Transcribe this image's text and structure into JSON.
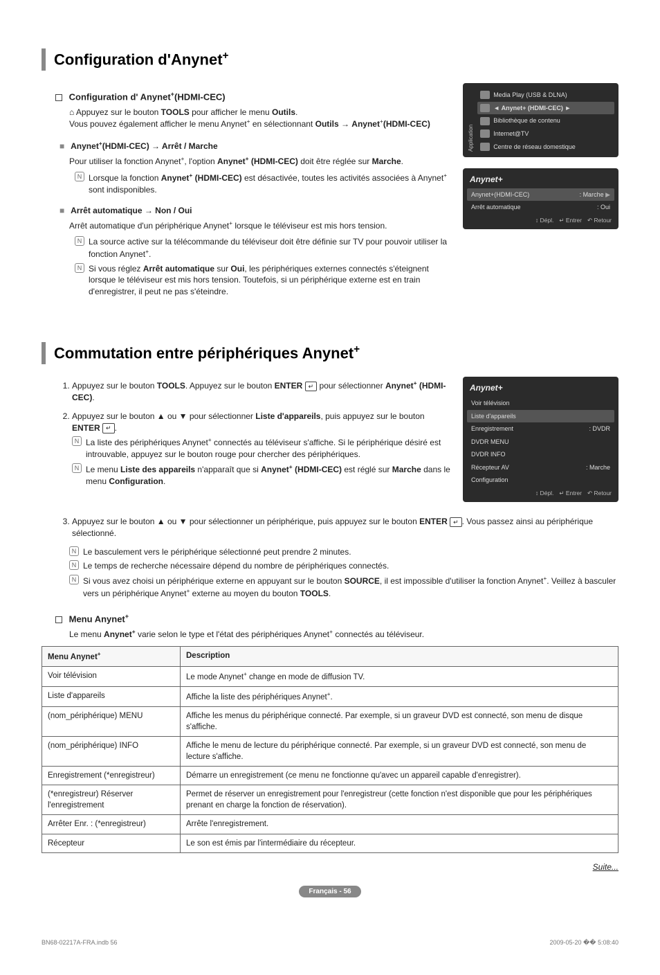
{
  "section1": {
    "title_prefix": "Configuration d'Anynet",
    "sup": "+",
    "sub1_prefix": "Configuration d' Anynet",
    "sub1_suffix": "(HDMI-CEC)",
    "p1a": "Appuyez sur le bouton ",
    "p1_tools": "TOOLS",
    "p1b": " pour afficher le menu ",
    "p1_outils": "Outils",
    "p1c": ".",
    "p2a": "Vous pouvez également afficher le menu Anynet",
    "p2b": " en sélectionnant ",
    "p2_outils": "Outils",
    "p2_arrow": " → ",
    "p2_anynet": "Anynet",
    "p2_suffix": "(HDMI-CEC)",
    "item1_head_a": "Anynet",
    "item1_head_b": "(HDMI-CEC) → Arrêt / Marche",
    "item1_p_a": "Pour utiliser la fonction Anynet",
    "item1_p_b": ", l'option ",
    "item1_p_anynet": "Anynet",
    "item1_p_sup": "+",
    "item1_p_hdmi": " (HDMI-CEC)",
    "item1_p_c": " doit être réglée sur ",
    "item1_p_marche": "Marche",
    "item1_p_d": ".",
    "note1a": "Lorsque la fonction ",
    "note1b": "Anynet",
    "note1sup": "+",
    "note1c": " (HDMI-CEC)",
    "note1d": " est désactivée, toutes les activités associées à Anynet",
    "note1e": " sont indisponibles.",
    "item2_head": "Arrêt automatique → Non / Oui",
    "item2_p_a": "Arrêt automatique d'un périphérique Anynet",
    "item2_p_b": " lorsque le téléviseur est mis hors tension.",
    "note2a": "La source active sur la télécommande du téléviseur doit être définie sur TV pour pouvoir utiliser la fonction Anynet",
    "note2b": ".",
    "note3a": "Si vous réglez ",
    "note3b": "Arrêt automatique",
    "note3c": " sur ",
    "note3d": "Oui",
    "note3e": ", les périphériques externes connectés s'éteignent lorsque le téléviseur est mis hors tension. Toutefois, si un périphérique externe est en train d'enregistrer, il peut ne pas s'éteindre."
  },
  "osd_app": {
    "sidebar": "Application",
    "items": [
      "Media Play (USB & DLNA)",
      "Anynet+ (HDMI-CEC)",
      "Bibliothèque de contenu",
      "Internet@TV",
      "Centre de réseau domestique"
    ],
    "selected": 1
  },
  "osd_anynet1": {
    "brand": "Anynet+",
    "rows": [
      {
        "label": "Anynet+(HDMI-CEC)",
        "value": ": Marche",
        "sel": true,
        "arrow": "▶"
      },
      {
        "label": "Arrêt automatique",
        "value": ": Oui"
      }
    ],
    "footer": [
      "Dépl.",
      "Entrer",
      "Retour"
    ]
  },
  "section2": {
    "title_prefix": "Commutation entre périphériques Anynet",
    "sup": "+",
    "step1a": "Appuyez sur le bouton ",
    "step1_tools": "TOOLS",
    "step1b": ". Appuyez sur le bouton ",
    "step1_enter": "ENTER",
    "step1c": " pour sélectionner ",
    "step1_anynet": "Anynet",
    "step1_sup": "+",
    "step1_hdmi": " (HDMI-CEC)",
    "step1d": ".",
    "step2a": "Appuyez sur le bouton ▲ ou ▼ pour sélectionner ",
    "step2_list": "Liste d'appareils",
    "step2b": ", puis appuyez sur le bouton ",
    "step2_enter": "ENTER",
    "step2c": ".",
    "note_s2_1a": "La liste des périphériques Anynet",
    "note_s2_1b": " connectés au téléviseur s'affiche. Si le périphérique désiré est introuvable, appuyez sur le bouton rouge pour chercher des périphériques.",
    "note_s2_2a": "Le menu ",
    "note_s2_2b": "Liste des appareils",
    "note_s2_2c": " n'apparaît que si ",
    "note_s2_2d": "Anynet",
    "note_s2_2sup": "+",
    "note_s2_2e": " (HDMI-CEC)",
    "note_s2_2f": " est réglé sur ",
    "note_s2_2g": "Marche",
    "note_s2_2h": " dans le menu ",
    "note_s2_2i": "Configuration",
    "note_s2_2j": ".",
    "step3a": "Appuyez sur le bouton ▲ ou ▼ pour sélectionner un périphérique, puis appuyez sur le bouton ",
    "step3_enter": "ENTER",
    "step3b": ". Vous passez ainsi au périphérique sélectionné.",
    "bnote1": "Le basculement vers le périphérique sélectionné peut prendre 2 minutes.",
    "bnote2": "Le temps de recherche nécessaire dépend du nombre de périphériques connectés.",
    "bnote3a": "Si vous avez choisi un périphérique externe en appuyant sur le bouton ",
    "bnote3b": "SOURCE",
    "bnote3c": ", il est impossible d'utiliser la fonction Anynet",
    "bnote3d": ". Veillez à basculer vers un périphérique Anynet",
    "bnote3e": " externe au moyen du bouton ",
    "bnote3f": "TOOLS",
    "bnote3g": ".",
    "menu_head_prefix": "Menu Anynet",
    "menu_sup": "+",
    "menu_intro_a": "Le menu ",
    "menu_intro_b": "Anynet",
    "menu_intro_c": " varie selon le type et l'état des périphériques Anynet",
    "menu_intro_d": " connectés au téléviseur."
  },
  "osd_anynet2": {
    "brand": "Anynet+",
    "rows": [
      {
        "label": "Voir télévision",
        "value": ""
      },
      {
        "label": "Liste d'appareils",
        "value": "",
        "sel": true
      },
      {
        "label": "Enregistrement",
        "value": ": DVDR"
      },
      {
        "label": "DVDR MENU",
        "value": ""
      },
      {
        "label": "DVDR INFO",
        "value": ""
      },
      {
        "label": "Récepteur AV",
        "value": ": Marche"
      },
      {
        "label": "Configuration",
        "value": ""
      }
    ],
    "footer": [
      "Dépl.",
      "Entrer",
      "Retour"
    ]
  },
  "table": {
    "h1": "Menu Anynet",
    "h1sup": "+",
    "h2": "Description",
    "rows": [
      {
        "c1": "Voir télévision",
        "c2a": "Le mode Anynet",
        "c2sup": "+",
        "c2b": " change en mode de diffusion TV."
      },
      {
        "c1": "Liste d'appareils",
        "c2a": "Affiche la liste des périphériques Anynet",
        "c2sup": "+",
        "c2b": "."
      },
      {
        "c1": "(nom_périphérique) MENU",
        "c2a": "Affiche les menus du périphérique connecté. Par exemple, si un graveur DVD est connecté, son menu de disque s'affiche.",
        "c2sup": "",
        "c2b": ""
      },
      {
        "c1": "(nom_périphérique) INFO",
        "c2a": "Affiche le menu de lecture du périphérique connecté. Par exemple, si un graveur DVD est connecté, son menu de lecture s'affiche.",
        "c2sup": "",
        "c2b": ""
      },
      {
        "c1": "Enregistrement (*enregistreur)",
        "c2a": "Démarre un enregistrement (ce menu ne fonctionne qu'avec un appareil capable d'enregistrer).",
        "c2sup": "",
        "c2b": ""
      },
      {
        "c1": "(*enregistreur) Réserver l'enregistrement",
        "c2a": "Permet de réserver un enregistrement pour l'enregistreur (cette fonction n'est disponible que pour les périphériques prenant en charge la fonction de réservation).",
        "c2sup": "",
        "c2b": ""
      },
      {
        "c1": "Arrêter Enr. : (*enregistreur)",
        "c2a": "Arrête l'enregistrement.",
        "c2sup": "",
        "c2b": ""
      },
      {
        "c1": "Récepteur",
        "c2a": "Le son est émis par l'intermédiaire du récepteur.",
        "c2sup": "",
        "c2b": ""
      }
    ]
  },
  "suite": "Suite...",
  "page_label": "Français - 56",
  "footer_left": "BN68-02217A-FRA.indb   56",
  "footer_right": "2009-05-20   �� 5:08:40",
  "icons": {
    "enter": "↵",
    "note": "N",
    "tool": "⌂",
    "depl": "↕",
    "entrer": "↵",
    "retour": "↶",
    "tri_left": "◄",
    "tri_right": "►"
  }
}
